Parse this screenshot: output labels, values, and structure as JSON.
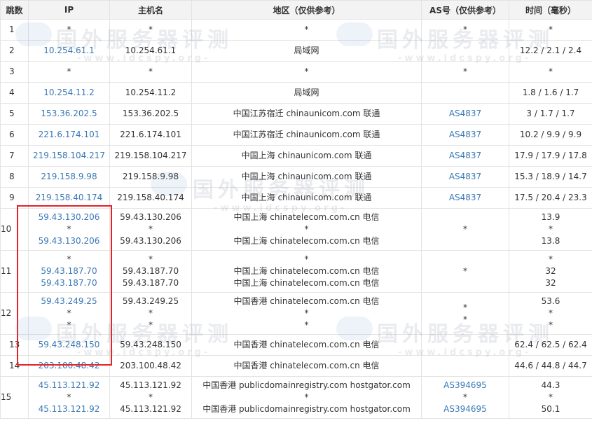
{
  "headers": {
    "hop": "跳数",
    "ip": "IP",
    "host": "主机名",
    "region": "地区（仅供参考）",
    "as": "AS号（仅供参考）",
    "time": "时间（毫秒）"
  },
  "watermark": {
    "text": "国外服务器评测",
    "url": "-www.idcspy.org-"
  },
  "colors": {
    "link": "#3a78b6",
    "header_bg": "#f3f3f3",
    "border": "#e3e3e3",
    "highlight": "#e2242a"
  },
  "rows": [
    {
      "hop": "1",
      "ip": [
        "*"
      ],
      "host": [
        "*"
      ],
      "region": [
        "*"
      ],
      "as": [
        "*"
      ],
      "time": [
        "*"
      ]
    },
    {
      "hop": "2",
      "ip": [
        "10.254.61.1"
      ],
      "host": [
        "10.254.61.1"
      ],
      "region": [
        "局域网"
      ],
      "as": [
        ""
      ],
      "time": [
        "12.2 / 2.1 / 2.4"
      ]
    },
    {
      "hop": "3",
      "ip": [
        "*"
      ],
      "host": [
        "*"
      ],
      "region": [
        "*"
      ],
      "as": [
        "*"
      ],
      "time": [
        "*"
      ]
    },
    {
      "hop": "4",
      "ip": [
        "10.254.11.2"
      ],
      "host": [
        "10.254.11.2"
      ],
      "region": [
        "局域网"
      ],
      "as": [
        ""
      ],
      "time": [
        "1.8 / 1.6 / 1.7"
      ]
    },
    {
      "hop": "5",
      "ip": [
        "153.36.202.5"
      ],
      "host": [
        "153.36.202.5"
      ],
      "region": [
        "中国江苏宿迁 chinaunicom.com 联通"
      ],
      "as": [
        "AS4837"
      ],
      "time": [
        "3 / 1.7 / 1.7"
      ]
    },
    {
      "hop": "6",
      "ip": [
        "221.6.174.101"
      ],
      "host": [
        "221.6.174.101"
      ],
      "region": [
        "中国江苏宿迁 chinaunicom.com 联通"
      ],
      "as": [
        "AS4837"
      ],
      "time": [
        "10.2 / 9.9 / 9.9"
      ]
    },
    {
      "hop": "7",
      "ip": [
        "219.158.104.217"
      ],
      "host": [
        "219.158.104.217"
      ],
      "region": [
        "中国上海 chinaunicom.com 联通"
      ],
      "as": [
        "AS4837"
      ],
      "time": [
        "17.9 / 17.9 / 17.8"
      ]
    },
    {
      "hop": "8",
      "ip": [
        "219.158.9.98"
      ],
      "host": [
        "219.158.9.98"
      ],
      "region": [
        "中国上海 chinaunicom.com 联通"
      ],
      "as": [
        "AS4837"
      ],
      "time": [
        "15.3 / 18.9 / 14.7"
      ]
    },
    {
      "hop": "9",
      "ip": [
        "219.158.40.174"
      ],
      "host": [
        "219.158.40.174"
      ],
      "region": [
        "中国上海 chinaunicom.com 联通"
      ],
      "as": [
        "AS4837"
      ],
      "time": [
        "17.5 / 20.4 / 23.3"
      ]
    },
    {
      "hop": "10",
      "ip": [
        "59.43.130.206",
        "*",
        "59.43.130.206"
      ],
      "host": [
        "59.43.130.206",
        "*",
        "59.43.130.206"
      ],
      "region": [
        "中国上海 chinatelecom.com.cn 电信",
        "*",
        "中国上海 chinatelecom.com.cn 电信"
      ],
      "as": [
        "*"
      ],
      "time": [
        "13.9",
        "*",
        "13.8"
      ]
    },
    {
      "hop": "11",
      "ip": [
        "*",
        "59.43.187.70",
        "59.43.187.70"
      ],
      "host": [
        "*",
        "59.43.187.70",
        "59.43.187.70"
      ],
      "region": [
        "*",
        "中国上海 chinatelecom.com.cn 电信",
        "中国上海 chinatelecom.com.cn 电信"
      ],
      "as": [
        "*"
      ],
      "time": [
        "*",
        "32",
        "32"
      ]
    },
    {
      "hop": "12",
      "ip": [
        "59.43.249.25",
        "*",
        "*"
      ],
      "host": [
        "59.43.249.25",
        "*",
        "*"
      ],
      "region": [
        "中国香港 chinatelecom.com.cn 电信",
        "*",
        "*"
      ],
      "as": [
        "*",
        "*"
      ],
      "time": [
        "53.6",
        "*",
        "*"
      ]
    },
    {
      "hop": "13",
      "ip": [
        "59.43.248.150"
      ],
      "host": [
        "59.43.248.150"
      ],
      "region": [
        "中国香港 chinatelecom.com.cn 电信"
      ],
      "as": [
        ""
      ],
      "time": [
        "62.4 / 62.5 / 62.4"
      ]
    },
    {
      "hop": "14",
      "ip": [
        "203.100.48.42"
      ],
      "host": [
        "203.100.48.42"
      ],
      "region": [
        "中国香港 chinatelecom.com.cn 电信"
      ],
      "as": [
        ""
      ],
      "time": [
        "44.6 / 44.8 / 44.7"
      ]
    },
    {
      "hop": "15",
      "ip": [
        "45.113.121.92",
        "*",
        "45.113.121.92"
      ],
      "host": [
        "45.113.121.92",
        "*",
        "45.113.121.92"
      ],
      "region": [
        "中国香港 publicdomainregistry.com hostgator.com",
        "*",
        "中国香港 publicdomainregistry.com hostgator.com"
      ],
      "as": [
        "AS394695",
        "*",
        "AS394695"
      ],
      "time": [
        "44.3",
        "*",
        "50.1"
      ]
    }
  ]
}
